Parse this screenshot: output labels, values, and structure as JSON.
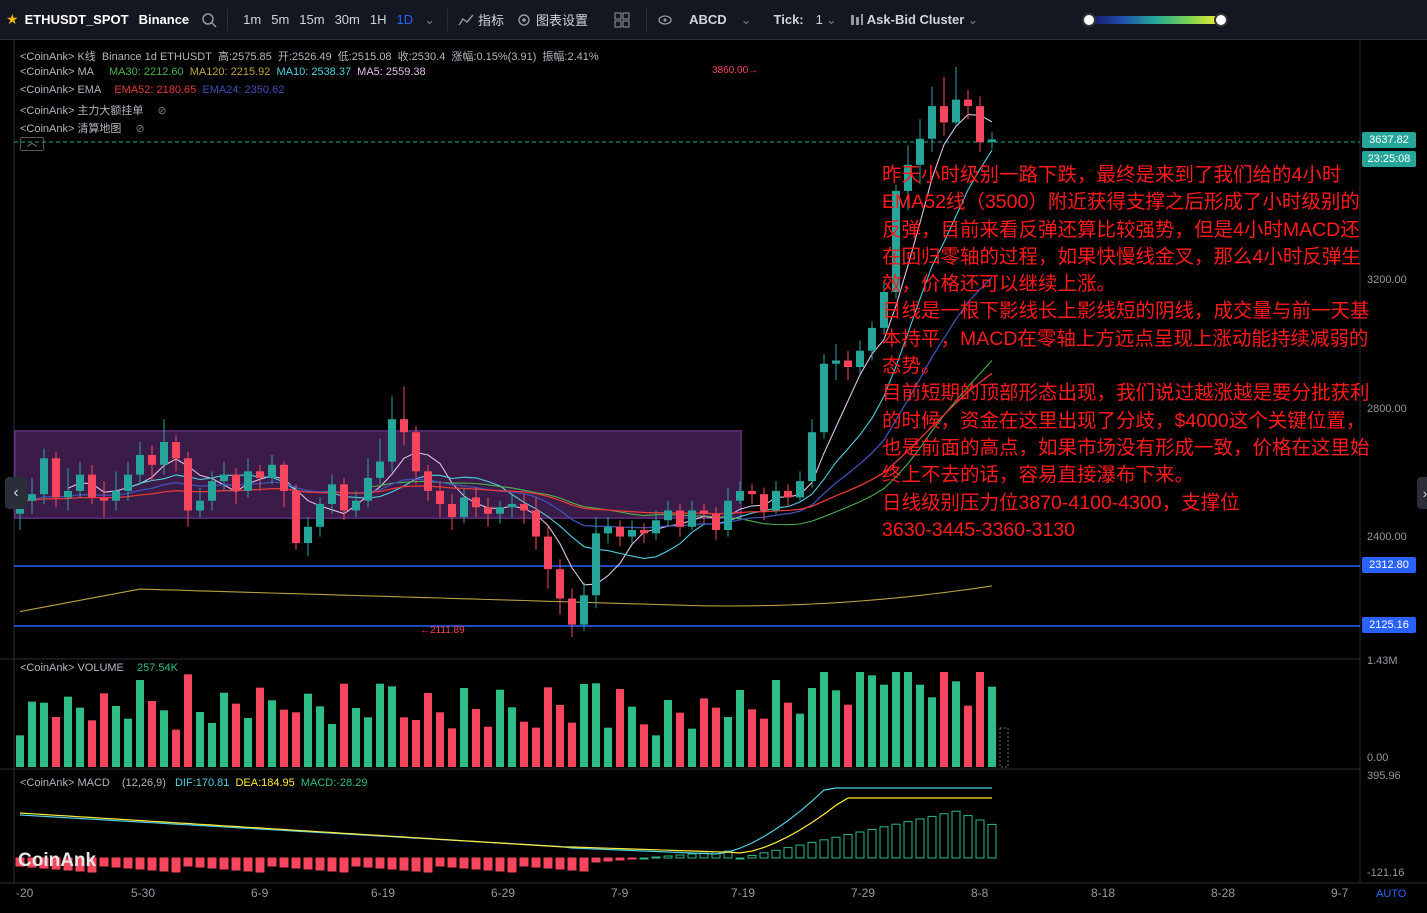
{
  "toolbar": {
    "symbol": "ETHUSDT_SPOT",
    "exchange": "Binance",
    "timeframes": [
      "1m",
      "5m",
      "15m",
      "30m",
      "1H",
      "1D"
    ],
    "active_timeframe": "1D",
    "indicators_label": "指标",
    "chart_settings_label": "图表设置",
    "drawing_label": "ABCD",
    "tick_label": "Tick:",
    "tick_value": "1",
    "cluster_label": "Ask-Bid Cluster",
    "colors": {
      "accent": "#2962ff",
      "bg": "#131722"
    }
  },
  "legend": {
    "kline": {
      "source": "<CoinAnk>",
      "name": "K线",
      "desc": "Binance 1d ETHUSDT",
      "high": "高:2575.85",
      "open": "开:2526.49",
      "low": "低:2515.08",
      "close": "收:2530.4",
      "change": "涨幅:0.15%(3.91)",
      "amp": "振幅:2.41%"
    },
    "ma": {
      "source": "<CoinAnk>",
      "name": "MA",
      "ma30": "MA30: 2212.60",
      "ma120": "MA120: 2215.92",
      "ma10": "MA10: 2538.37",
      "ma5": "MA5: 2559.38"
    },
    "ema": {
      "source": "<CoinAnk>",
      "name": "EMA",
      "ema52": "EMA52: 2180.65",
      "ema24": "EMA24: 2350.62"
    },
    "whale": {
      "source": "<CoinAnk>",
      "name": "主力大额挂单"
    },
    "liq": {
      "source": "<CoinAnk>",
      "name": "清算地图"
    },
    "volume": {
      "source": "<CoinAnk>",
      "name": "VOLUME",
      "value": "257.54K"
    },
    "macd": {
      "source": "<CoinAnk>",
      "name": "MACD",
      "params": "(12,26,9)",
      "dif": "DIF:170.81",
      "dea": "DEA:184.95",
      "macd": "MACD:-28.29"
    }
  },
  "price_axis": {
    "labels": [
      "3200.00",
      "2800.00",
      "2400.00"
    ],
    "current_price": "3637.82",
    "countdown": "23:25:08",
    "line1": "2312.80",
    "line2": "2125.16",
    "vol_max": "1.43M",
    "vol_min": "0.00",
    "macd_max": "395.96",
    "macd_min": "-121.16"
  },
  "annotations": {
    "high_label": "3860.00→",
    "low_label": "←2111.89",
    "note": "昨天小时级别一路下跌，最终是来到了我们给的4小时EMA52线（3500）附近获得支撑之后形成了小时级别的反弹，目前来看反弹还算比较强势，但是4小时MACD还在回归零轴的过程，如果快慢线金叉，那么4小时反弹生效，价格还可以继续上涨。\n日线是一根下影线长上影线短的阴线，成交量与前一天基本持平，MACD在零轴上方远点呈现上涨动能持续减弱的态势。\n目前短期的顶部形态出现，我们说过越涨越是要分批获利的时候，资金在这里出现了分歧，$4000这个关键位置，也是前面的高点，如果市场没有形成一致，价格在这里始终上不去的话，容易直接瀑布下来。\n日线级别压力位3870-4100-4300，支撑位\n3630-3445-3360-3130"
  },
  "time_axis": [
    "-20",
    "5-30",
    "6-9",
    "6-19",
    "6-29",
    "7-9",
    "7-19",
    "7-29",
    "8-8",
    "8-18",
    "8-28",
    "9-7"
  ],
  "watermark": "CoinAnk",
  "auto_label": "AUTO",
  "colors": {
    "up": "#26a69a",
    "up_bright": "#2dbd85",
    "down": "#f6465d",
    "note": "#ff1a1a",
    "box": "#8e44ad",
    "hline": "#2962ff"
  },
  "chart_data": {
    "type": "candlestick",
    "ylim": [
      2080,
      3900
    ],
    "x_start": "2025-05-19",
    "hlines": [
      2312.8,
      2125.16
    ],
    "candles": [
      [
        2490,
        2530,
        2600,
        2440
      ],
      [
        2530,
        2550,
        2600,
        2490
      ],
      [
        2550,
        2660,
        2690,
        2520
      ],
      [
        2660,
        2540,
        2680,
        2510
      ],
      [
        2540,
        2560,
        2630,
        2500
      ],
      [
        2560,
        2610,
        2650,
        2540
      ],
      [
        2610,
        2540,
        2640,
        2520
      ],
      [
        2540,
        2530,
        2590,
        2480
      ],
      [
        2530,
        2560,
        2620,
        2500
      ],
      [
        2560,
        2610,
        2650,
        2530
      ],
      [
        2610,
        2670,
        2710,
        2580
      ],
      [
        2670,
        2640,
        2700,
        2590
      ],
      [
        2640,
        2710,
        2780,
        2610
      ],
      [
        2710,
        2660,
        2730,
        2620
      ],
      [
        2660,
        2500,
        2680,
        2450
      ],
      [
        2500,
        2530,
        2570,
        2480
      ],
      [
        2530,
        2590,
        2620,
        2500
      ],
      [
        2590,
        2610,
        2650,
        2560
      ],
      [
        2610,
        2560,
        2630,
        2520
      ],
      [
        2560,
        2620,
        2660,
        2540
      ],
      [
        2620,
        2600,
        2640,
        2560
      ],
      [
        2600,
        2640,
        2670,
        2580
      ],
      [
        2640,
        2560,
        2650,
        2510
      ],
      [
        2560,
        2400,
        2580,
        2380
      ],
      [
        2400,
        2450,
        2480,
        2360
      ],
      [
        2450,
        2520,
        2540,
        2420
      ],
      [
        2520,
        2580,
        2610,
        2490
      ],
      [
        2580,
        2500,
        2600,
        2470
      ],
      [
        2500,
        2530,
        2560,
        2480
      ],
      [
        2530,
        2600,
        2660,
        2510
      ],
      [
        2600,
        2650,
        2720,
        2580
      ],
      [
        2650,
        2780,
        2850,
        2620
      ],
      [
        2780,
        2740,
        2880,
        2700
      ],
      [
        2740,
        2620,
        2760,
        2580
      ],
      [
        2620,
        2560,
        2640,
        2530
      ],
      [
        2560,
        2520,
        2590,
        2480
      ],
      [
        2520,
        2480,
        2550,
        2440
      ],
      [
        2480,
        2540,
        2570,
        2460
      ],
      [
        2540,
        2510,
        2570,
        2480
      ],
      [
        2510,
        2490,
        2540,
        2450
      ],
      [
        2490,
        2510,
        2530,
        2460
      ],
      [
        2510,
        2520,
        2550,
        2480
      ],
      [
        2520,
        2500,
        2550,
        2460
      ],
      [
        2500,
        2420,
        2540,
        2380
      ],
      [
        2420,
        2320,
        2450,
        2260
      ],
      [
        2320,
        2230,
        2350,
        2180
      ],
      [
        2230,
        2150,
        2260,
        2112
      ],
      [
        2150,
        2240,
        2280,
        2130
      ],
      [
        2240,
        2430,
        2480,
        2200
      ],
      [
        2430,
        2450,
        2480,
        2400
      ],
      [
        2450,
        2420,
        2470,
        2390
      ],
      [
        2420,
        2440,
        2470,
        2400
      ],
      [
        2440,
        2430,
        2460,
        2400
      ],
      [
        2430,
        2470,
        2500,
        2410
      ],
      [
        2470,
        2500,
        2530,
        2450
      ],
      [
        2500,
        2450,
        2520,
        2420
      ],
      [
        2450,
        2500,
        2530,
        2440
      ],
      [
        2500,
        2490,
        2520,
        2460
      ],
      [
        2490,
        2440,
        2510,
        2410
      ],
      [
        2440,
        2530,
        2570,
        2420
      ],
      [
        2530,
        2560,
        2590,
        2520
      ],
      [
        2560,
        2550,
        2580,
        2520
      ],
      [
        2550,
        2500,
        2570,
        2470
      ],
      [
        2500,
        2560,
        2590,
        2490
      ],
      [
        2560,
        2540,
        2580,
        2510
      ],
      [
        2540,
        2590,
        2620,
        2530
      ],
      [
        2590,
        2740,
        2780,
        2570
      ],
      [
        2740,
        2950,
        2980,
        2720
      ],
      [
        2950,
        2960,
        3010,
        2900
      ],
      [
        2960,
        2940,
        2990,
        2900
      ],
      [
        2940,
        2990,
        3020,
        2920
      ],
      [
        2990,
        3060,
        3080,
        2960
      ],
      [
        3060,
        3170,
        3200,
        3040
      ],
      [
        3170,
        3480,
        3500,
        3150
      ],
      [
        3480,
        3560,
        3620,
        3420
      ],
      [
        3560,
        3640,
        3700,
        3500
      ],
      [
        3640,
        3740,
        3800,
        3600
      ],
      [
        3740,
        3690,
        3830,
        3650
      ],
      [
        3690,
        3760,
        3860,
        3680
      ],
      [
        3760,
        3740,
        3790,
        3700
      ],
      [
        3740,
        3630,
        3770,
        3600
      ],
      [
        3630,
        3638,
        3660,
        3610
      ]
    ]
  }
}
